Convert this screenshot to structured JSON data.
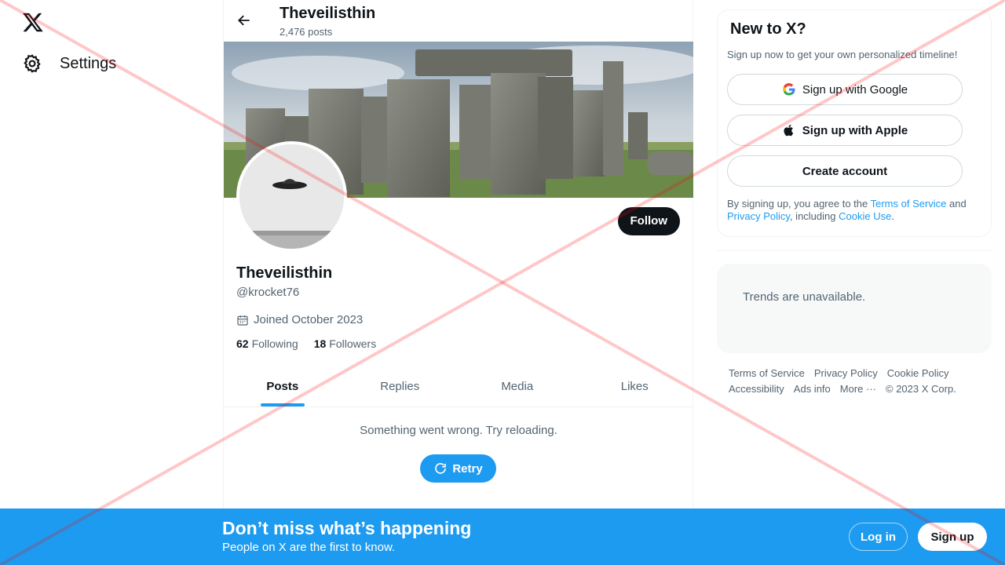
{
  "nav": {
    "settings_label": "Settings"
  },
  "header": {
    "name": "Theveilisthin",
    "posts_count": "2,476 posts"
  },
  "profile": {
    "name": "Theveilisthin",
    "handle": "@krocket76",
    "joined": "Joined October 2023",
    "following_count": "62",
    "following_label": "Following",
    "followers_count": "18",
    "followers_label": "Followers",
    "follow_label": "Follow"
  },
  "tabs": [
    {
      "label": "Posts"
    },
    {
      "label": "Replies"
    },
    {
      "label": "Media"
    },
    {
      "label": "Likes"
    }
  ],
  "feed": {
    "error_message": "Something went wrong. Try reloading.",
    "retry_label": "Retry"
  },
  "signup_card": {
    "title": "New to X?",
    "subtitle": "Sign up now to get your own personalized timeline!",
    "google_label": "Sign up with Google",
    "apple_label": "Sign up with Apple",
    "create_label": "Create account",
    "terms_prefix": "By signing up, you agree to the ",
    "terms_link": "Terms of Service",
    "terms_and": " and ",
    "privacy_link": "Privacy Policy",
    "terms_including": ", including ",
    "cookie_link": "Cookie Use",
    "terms_end": "."
  },
  "trends": {
    "message": "Trends are unavailable."
  },
  "footer": {
    "terms": "Terms of Service",
    "privacy": "Privacy Policy",
    "cookie": "Cookie Policy",
    "accessibility": "Accessibility",
    "ads": "Ads info",
    "more": "More ···",
    "copyright": "© 2023 X Corp."
  },
  "bottom_bar": {
    "title": "Don’t miss what’s happening",
    "subtitle": "People on X are the first to know.",
    "login_label": "Log in",
    "signup_label": "Sign up"
  },
  "colors": {
    "accent": "#1d9bf0",
    "text": "#0f1419",
    "muted": "#536471",
    "cross": "#ff0000"
  }
}
